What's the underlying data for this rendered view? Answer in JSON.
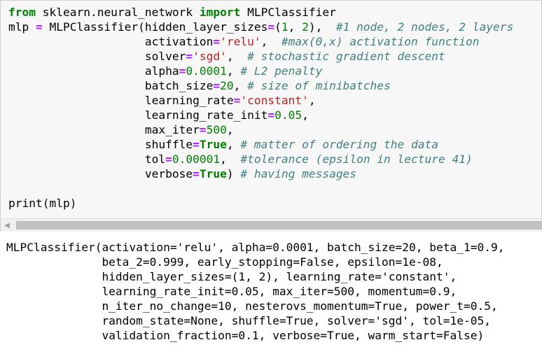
{
  "code_lines": [
    [
      {
        "t": "from",
        "c": "kw"
      },
      {
        "t": " sklearn.neural_network ",
        "c": ""
      },
      {
        "t": "import",
        "c": "kw"
      },
      {
        "t": " MLPClassifier",
        "c": ""
      }
    ],
    [
      {
        "t": "mlp ",
        "c": ""
      },
      {
        "t": "=",
        "c": "op"
      },
      {
        "t": " MLPClassifier(hidden_layer_sizes",
        "c": ""
      },
      {
        "t": "=",
        "c": "op"
      },
      {
        "t": "(",
        "c": ""
      },
      {
        "t": "1",
        "c": "num"
      },
      {
        "t": ", ",
        "c": ""
      },
      {
        "t": "2",
        "c": "num"
      },
      {
        "t": "),  ",
        "c": ""
      },
      {
        "t": "#1 node, 2 nodes, 2 layers",
        "c": "cmt"
      }
    ],
    [
      {
        "t": "                    activation",
        "c": ""
      },
      {
        "t": "=",
        "c": "op"
      },
      {
        "t": "'relu'",
        "c": "str"
      },
      {
        "t": ",  ",
        "c": ""
      },
      {
        "t": "#max(0,x) activation function",
        "c": "cmt"
      }
    ],
    [
      {
        "t": "                    solver",
        "c": ""
      },
      {
        "t": "=",
        "c": "op"
      },
      {
        "t": "'sgd'",
        "c": "str"
      },
      {
        "t": ",  ",
        "c": ""
      },
      {
        "t": "# stochastic gradient descent",
        "c": "cmt"
      }
    ],
    [
      {
        "t": "                    alpha",
        "c": ""
      },
      {
        "t": "=",
        "c": "op"
      },
      {
        "t": "0.0001",
        "c": "num"
      },
      {
        "t": ", ",
        "c": ""
      },
      {
        "t": "# L2 penalty",
        "c": "cmt"
      }
    ],
    [
      {
        "t": "                    batch_size",
        "c": ""
      },
      {
        "t": "=",
        "c": "op"
      },
      {
        "t": "20",
        "c": "num"
      },
      {
        "t": ", ",
        "c": ""
      },
      {
        "t": "# size of minibatches",
        "c": "cmt"
      }
    ],
    [
      {
        "t": "                    learning_rate",
        "c": ""
      },
      {
        "t": "=",
        "c": "op"
      },
      {
        "t": "'constant'",
        "c": "str"
      },
      {
        "t": ",",
        "c": ""
      }
    ],
    [
      {
        "t": "                    learning_rate_init",
        "c": ""
      },
      {
        "t": "=",
        "c": "op"
      },
      {
        "t": "0.05",
        "c": "num"
      },
      {
        "t": ",",
        "c": ""
      }
    ],
    [
      {
        "t": "                    max_iter",
        "c": ""
      },
      {
        "t": "=",
        "c": "op"
      },
      {
        "t": "500",
        "c": "num"
      },
      {
        "t": ",",
        "c": ""
      }
    ],
    [
      {
        "t": "                    shuffle",
        "c": ""
      },
      {
        "t": "=",
        "c": "op"
      },
      {
        "t": "True",
        "c": "kc"
      },
      {
        "t": ", ",
        "c": ""
      },
      {
        "t": "# matter of ordering the data",
        "c": "cmt"
      }
    ],
    [
      {
        "t": "                    tol",
        "c": ""
      },
      {
        "t": "=",
        "c": "op"
      },
      {
        "t": "0.00001",
        "c": "num"
      },
      {
        "t": ",  ",
        "c": ""
      },
      {
        "t": "#tolerance (epsilon in lecture 41)",
        "c": "cmt"
      }
    ],
    [
      {
        "t": "                    verbose",
        "c": ""
      },
      {
        "t": "=",
        "c": "op"
      },
      {
        "t": "True",
        "c": "kc"
      },
      {
        "t": ") ",
        "c": ""
      },
      {
        "t": "# having messages",
        "c": "cmt"
      }
    ],
    [
      {
        "t": "",
        "c": ""
      }
    ],
    [
      {
        "t": "print",
        "c": "fn"
      },
      {
        "t": "(mlp)",
        "c": ""
      }
    ]
  ],
  "scrollbar": {
    "left_arrow": "◀"
  },
  "output_lines": [
    "MLPClassifier(activation='relu', alpha=0.0001, batch_size=20, beta_1=0.9,",
    "              beta_2=0.999, early_stopping=False, epsilon=1e-08,",
    "              hidden_layer_sizes=(1, 2), learning_rate='constant',",
    "              learning_rate_init=0.05, max_iter=500, momentum=0.9,",
    "              n_iter_no_change=10, nesterovs_momentum=True, power_t=0.5,",
    "              random_state=None, shuffle=True, solver='sgd', tol=1e-05,",
    "              validation_fraction=0.1, verbose=True, warm_start=False)"
  ]
}
